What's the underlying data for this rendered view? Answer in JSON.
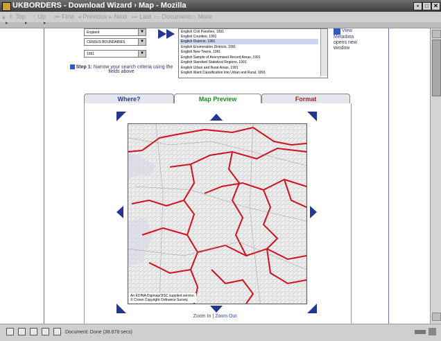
{
  "window": {
    "title": "UKBORDERS - Download Wizard › Map - Mozilla",
    "min": "▪",
    "max": "□",
    "close": "✕"
  },
  "toolbar": {
    "top": "Top",
    "up": "Up",
    "first": "First",
    "previous": "Previous",
    "next": "Next",
    "last": "Last",
    "document": "Document",
    "more": "More"
  },
  "tabbar": {
    "markers": [
      "▸",
      "▸",
      "▸"
    ]
  },
  "search": {
    "selects": [
      "England",
      "CENSUS BOUNDARIES",
      "1991"
    ],
    "list_items": [
      "English Civil Parishes, 1991",
      "English Counties, 1991",
      "English Districts, 1991",
      "English Enumeration Districts, 1991",
      "English New Towns, 1991",
      "English Sample of Anonymised Record Areas, 1991",
      "English Standard Statistical Regions, 1991",
      "English Urban and Rural Areas, 1991",
      "English Ward Classification into Urban and Rural, 1991"
    ],
    "selected_index": 2,
    "step_label": "Step 1:",
    "step_text": "Narrow your search criteria using the",
    "step_text2": "fields above",
    "metadata_link": "View",
    "metadata_link2": "Metadata",
    "metadata_note": "opens new",
    "metadata_note2": "window"
  },
  "tabs": [
    {
      "label": "Where?",
      "color": "#2a3c8c"
    },
    {
      "label": "Map Preview",
      "color": "#1f8a1f"
    },
    {
      "label": "Format",
      "color": "#a82020"
    }
  ],
  "map": {
    "note1": "An EDINA Digimap/JISC supplied service.",
    "note2": "© Crown Copyright Ordnance Survey."
  },
  "zoom": {
    "in": "Zoom In",
    "sep": " | ",
    "out": "Zoom Out"
  },
  "status": {
    "text": "Document: Done (38.878 secs)"
  },
  "colors": {
    "arrow": "#23378f",
    "boundary": "#d0101a",
    "link": "#2645a8"
  }
}
